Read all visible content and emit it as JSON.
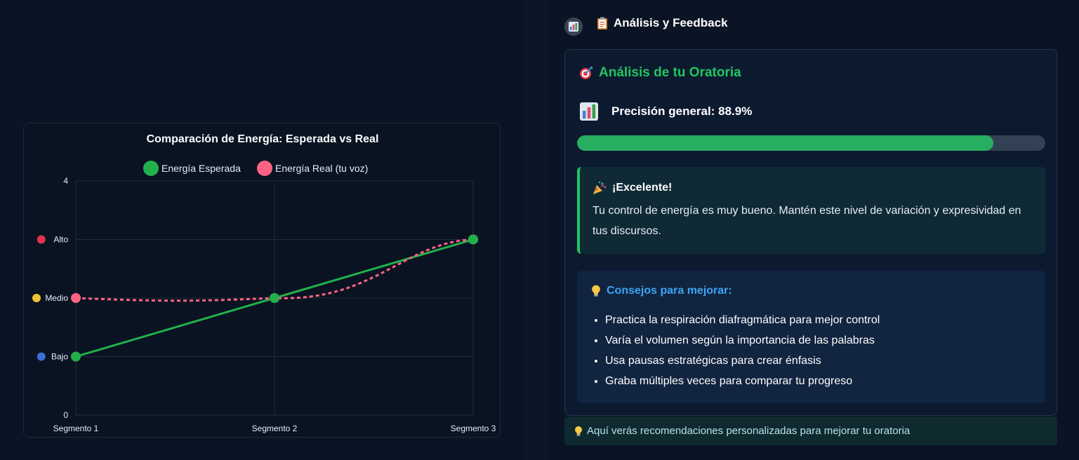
{
  "chart_data": {
    "type": "line",
    "title": "Comparación de Energía: Esperada vs Real",
    "categories": [
      "Segmento 1",
      "Segmento 2",
      "Segmento 3"
    ],
    "ylim": [
      0,
      4
    ],
    "yticks": [
      {
        "value": 4,
        "label": "4"
      },
      {
        "value": 3,
        "label": "Alto",
        "dot_color": "#e0344e"
      },
      {
        "value": 2,
        "label": "Medio",
        "dot_color": "#f0c030"
      },
      {
        "value": 1,
        "label": "Bajo",
        "dot_color": "#3b6fd6"
      },
      {
        "value": 0,
        "label": "0"
      }
    ],
    "series": [
      {
        "name": "Energía Esperada",
        "values": [
          1,
          2,
          3
        ],
        "color": "#22b04b",
        "style": "solid"
      },
      {
        "name": "Energía Real (tu voz)",
        "values": [
          2,
          2,
          3
        ],
        "color": "#ff6384",
        "style": "dashed"
      }
    ],
    "legend": "top",
    "grid": true
  },
  "panel": {
    "badge_icon": "bar-chart-icon",
    "header_icon": "clipboard-icon",
    "header_title": "Análisis y Feedback"
  },
  "analysis": {
    "title_icon": "target-icon",
    "title": "Análisis de tu Oratoria",
    "precision_icon": "bar-chart-icon",
    "precision_label": "Precisión general: 88.9%",
    "precision_value": 0.889,
    "progress_color": "#27ae60",
    "excellent_icon": "party-popper-icon",
    "excellent_heading": "¡Excelente!",
    "excellent_body": "Tu control de energía es muy bueno. Mantén este nivel de variación y expresividad en tus discursos.",
    "tips_icon": "lightbulb-icon",
    "tips_heading": "Consejos para mejorar:",
    "tips": [
      "Practica la respiración diafragmática para mejor control",
      "Varía el volumen según la importancia de las palabras",
      "Usa pausas estratégicas para crear énfasis",
      "Graba múltiples veces para comparar tu progreso"
    ]
  },
  "footer": {
    "icon": "lightbulb-icon",
    "text": "Aquí verás recomendaciones personalizadas para mejorar tu oratoria"
  },
  "colors": {
    "accent_green": "#22c55e",
    "accent_blue": "#3da5f5",
    "background": "#0a1424"
  }
}
